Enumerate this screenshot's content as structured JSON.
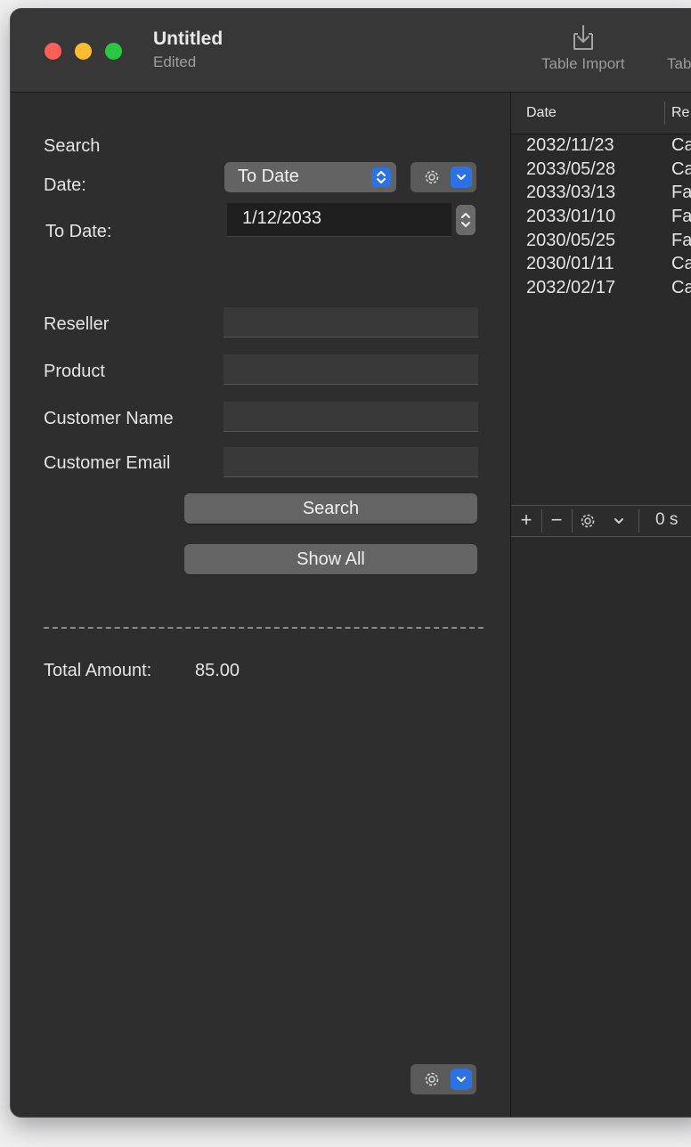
{
  "window": {
    "title": "Untitled",
    "subtitle": "Edited"
  },
  "toolbar": {
    "items": [
      {
        "label": "Table Import",
        "icon": "tray-arrow-down-icon"
      },
      {
        "label": "Tab",
        "icon": "tray-arrow-down-icon"
      }
    ]
  },
  "sidebar": {
    "search_heading": "Search",
    "date_label": "Date:",
    "date_popup_value": "To Date",
    "to_date_label": "To Date:",
    "to_date_value": "1/12/2033",
    "reseller_label": "Reseller",
    "reseller_value": "",
    "product_label": "Product",
    "product_value": "",
    "customer_name_label": "Customer Name",
    "customer_name_value": "",
    "customer_email_label": "Customer Email",
    "customer_email_value": "",
    "search_button": "Search",
    "show_all_button": "Show All",
    "total_label": "Total Amount:",
    "total_value": "85.00"
  },
  "table": {
    "columns": [
      "Date",
      "Re"
    ],
    "rows": [
      [
        "2032/11/23",
        "Ca"
      ],
      [
        "2033/05/28",
        "Ca"
      ],
      [
        "2033/03/13",
        "Fa"
      ],
      [
        "2033/01/10",
        "Fa"
      ],
      [
        "2030/05/25",
        "Fa"
      ],
      [
        "2030/01/11",
        "Ca"
      ],
      [
        "2032/02/17",
        "Ca"
      ]
    ],
    "bottom_bar": {
      "add": "+",
      "remove": "−",
      "status": "0 s"
    }
  },
  "colors": {
    "window_bg": "#2e2e2e",
    "accent": "#2a72e6",
    "close": "#fe5f57",
    "minimize": "#febc2e",
    "zoom": "#28c840"
  }
}
